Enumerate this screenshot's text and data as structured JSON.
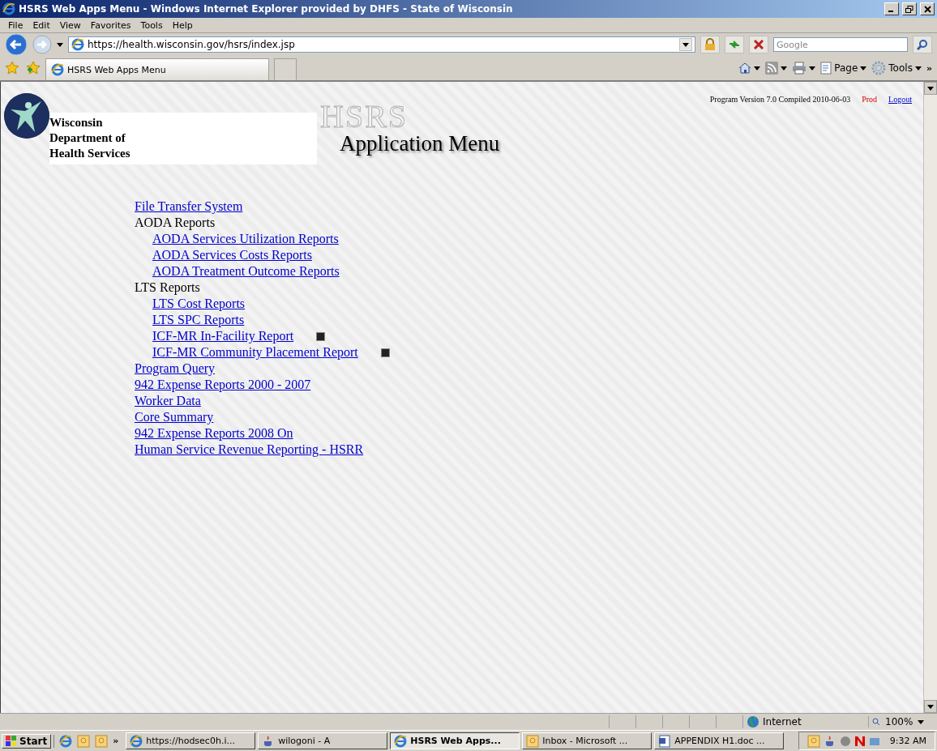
{
  "window": {
    "title": "HSRS Web Apps Menu - Windows Internet Explorer provided by DHFS - State of Wisconsin"
  },
  "menu_bar": [
    "File",
    "Edit",
    "View",
    "Favorites",
    "Tools",
    "Help"
  ],
  "address_bar": {
    "value": "https://health.wisconsin.gov/hsrs/index.jsp"
  },
  "search": {
    "placeholder": "Google"
  },
  "tabs": [
    {
      "label": "HSRS Web Apps Menu",
      "selected": true
    }
  ],
  "command_bar": [
    {
      "kind": "home"
    },
    {
      "kind": "feeds"
    },
    {
      "kind": "print"
    },
    {
      "kind": "page",
      "label": "Page"
    },
    {
      "kind": "tools",
      "label": "Tools"
    }
  ],
  "command_bar_overflow": "»",
  "page": {
    "version_info": "Program Version 7.0 Compiled 2010-06-03",
    "environment": "Prod",
    "logout": "Logout",
    "org_name": [
      "Wisconsin",
      "Department of",
      "Health Services"
    ],
    "logo_text": "HSRS",
    "heading": "Application Menu",
    "menu": [
      {
        "kind": "link",
        "label": "File Transfer System"
      },
      {
        "kind": "heading",
        "label": "AODA Reports",
        "children": [
          {
            "kind": "link",
            "label": "AODA Services Utilization Reports"
          },
          {
            "kind": "link",
            "label": "AODA Services Costs Reports"
          },
          {
            "kind": "link",
            "label": "AODA Treatment Outcome Reports"
          }
        ]
      },
      {
        "kind": "heading",
        "label": "LTS Reports",
        "children": [
          {
            "kind": "link",
            "label": "LTS Cost Reports"
          },
          {
            "kind": "link",
            "label": "LTS SPC Reports"
          },
          {
            "kind": "link",
            "label": "ICF-MR In-Facility Report",
            "broken_image": true
          },
          {
            "kind": "link",
            "label": "ICF-MR Community Placement Report",
            "broken_image": true
          }
        ]
      },
      {
        "kind": "link",
        "label": "Program Query"
      },
      {
        "kind": "link",
        "label": "942 Expense Reports 2000 - 2007"
      },
      {
        "kind": "link",
        "label": "Worker Data"
      },
      {
        "kind": "link",
        "label": "Core Summary"
      },
      {
        "kind": "link",
        "label": "942 Expense Reports 2008 On"
      },
      {
        "kind": "link",
        "label": "Human Service Revenue Reporting - HSRR"
      }
    ]
  },
  "status_bar": {
    "zone": "Internet",
    "zoom": "100%"
  },
  "taskbar": {
    "start": "Start",
    "overflow": "»",
    "tasks": [
      {
        "label": "https://hodsec0h.i...",
        "kind": "ie",
        "selected": false
      },
      {
        "label": "wilogoni - A",
        "kind": "java",
        "selected": false
      },
      {
        "label": "HSRS Web Apps...",
        "kind": "ie",
        "selected": true
      },
      {
        "label": "Inbox - Microsoft ...",
        "kind": "mail",
        "selected": false
      },
      {
        "label": "APPENDIX H1.doc ...",
        "kind": "word",
        "selected": false
      }
    ],
    "clock": "9:32 AM"
  }
}
